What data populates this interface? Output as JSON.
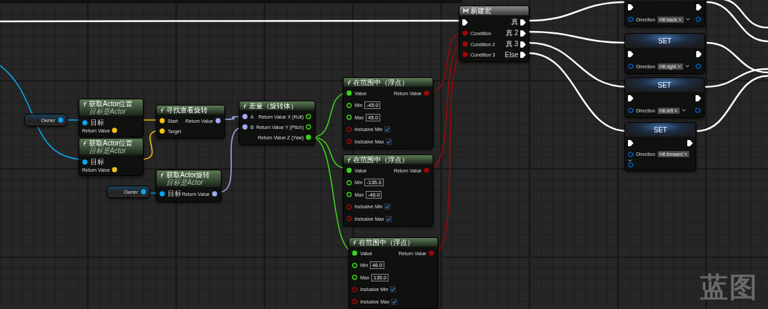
{
  "graph": {
    "watermark": "蓝图",
    "nodes": [
      {
        "kind": "variable",
        "title": "Owner",
        "outputs": [
          {
            "kind": "object",
            "connected": true
          }
        ]
      },
      {
        "kind": "function",
        "title": "获取Actor位置",
        "subtitle": "目标是Actor",
        "inputs": [
          {
            "label": "目标",
            "kind": "object",
            "connected": true
          }
        ],
        "outputs": [
          {
            "label": "Return Value",
            "kind": "vector",
            "connected": true
          }
        ]
      },
      {
        "kind": "function",
        "title": "获取Actor位置",
        "subtitle": "目标是Actor",
        "inputs": [
          {
            "label": "目标",
            "kind": "object",
            "connected": true
          }
        ],
        "outputs": [
          {
            "label": "Return Value",
            "kind": "vector",
            "connected": true
          }
        ]
      },
      {
        "kind": "function",
        "title": "寻找查看旋转",
        "inputs": [
          {
            "label": "Start",
            "kind": "vector",
            "connected": true
          },
          {
            "label": "Target",
            "kind": "vector",
            "connected": true
          }
        ],
        "outputs": [
          {
            "label": "Return Value",
            "kind": "rotator",
            "connected": true
          }
        ]
      },
      {
        "kind": "variable",
        "title": "Owner",
        "outputs": [
          {
            "kind": "object",
            "connected": true
          }
        ]
      },
      {
        "kind": "function",
        "title": "获取Actor旋转",
        "subtitle": "目标是Actor",
        "inputs": [
          {
            "label": "目标",
            "kind": "object",
            "connected": true
          }
        ],
        "outputs": [
          {
            "label": "Return Value",
            "kind": "rotator",
            "connected": true
          }
        ]
      },
      {
        "kind": "function",
        "title": "差量（旋转体）",
        "inputs": [
          {
            "label": "A",
            "kind": "rotator",
            "connected": true
          },
          {
            "label": "B",
            "kind": "rotator",
            "connected": true
          }
        ],
        "outputs": [
          {
            "label": "Return Value X (Roll)",
            "kind": "float",
            "connected": false
          },
          {
            "label": "Return Value Y (Pitch)",
            "kind": "float",
            "connected": false
          },
          {
            "label": "Return Value Z (Yaw)",
            "kind": "float",
            "connected": true
          }
        ]
      },
      {
        "kind": "function",
        "title": "在范围中（浮点）",
        "inputs": [
          {
            "label": "Value",
            "kind": "float",
            "connected": true
          },
          {
            "label": "Min",
            "kind": "float",
            "connected": false,
            "value": "-45.0"
          },
          {
            "label": "Max",
            "kind": "float",
            "connected": false,
            "value": "45.0"
          },
          {
            "label": "Inclusive Min",
            "kind": "bool",
            "connected": false,
            "checked": true
          },
          {
            "label": "Inclusive Max",
            "kind": "bool",
            "connected": false,
            "checked": true
          }
        ],
        "outputs": [
          {
            "label": "Return Value",
            "kind": "bool",
            "connected": true
          }
        ]
      },
      {
        "kind": "function",
        "title": "在范围中（浮点）",
        "inputs": [
          {
            "label": "Value",
            "kind": "float",
            "connected": true
          },
          {
            "label": "Min",
            "kind": "float",
            "connected": false,
            "value": "-135.0"
          },
          {
            "label": "Max",
            "kind": "float",
            "connected": false,
            "value": "-46.0"
          },
          {
            "label": "Inclusive Min",
            "kind": "bool",
            "connected": false,
            "checked": true
          },
          {
            "label": "Inclusive Max",
            "kind": "bool",
            "connected": false,
            "checked": true
          }
        ],
        "outputs": [
          {
            "label": "Return Value",
            "kind": "bool",
            "connected": true
          }
        ]
      },
      {
        "kind": "function",
        "title": "在范围中（浮点）",
        "inputs": [
          {
            "label": "Value",
            "kind": "float",
            "connected": true
          },
          {
            "label": "Min",
            "kind": "float",
            "connected": false,
            "value": "46.0"
          },
          {
            "label": "Max",
            "kind": "float",
            "connected": false,
            "value": "135.0"
          },
          {
            "label": "Inclusive Min",
            "kind": "bool",
            "connected": false,
            "checked": true
          },
          {
            "label": "Inclusive Max",
            "kind": "bool",
            "connected": false,
            "checked": true
          }
        ],
        "outputs": [
          {
            "label": "Return Value",
            "kind": "bool",
            "connected": true
          }
        ]
      },
      {
        "kind": "macro",
        "title": "新建宏",
        "inputs": [
          {
            "kind": "exec",
            "connected": true
          },
          {
            "label": "Condition",
            "kind": "bool",
            "connected": true
          },
          {
            "label": "Condition 2",
            "kind": "bool",
            "connected": true
          },
          {
            "label": "Condition 3",
            "kind": "bool",
            "connected": true
          }
        ],
        "outputs": [
          {
            "label": "真",
            "kind": "exec",
            "connected": true
          },
          {
            "label": "真 2",
            "kind": "exec",
            "connected": true
          },
          {
            "label": "真 3",
            "kind": "exec",
            "connected": true
          },
          {
            "label": "Else",
            "kind": "exec",
            "connected": true
          }
        ]
      },
      {
        "kind": "set",
        "inputs": [
          {
            "kind": "exec",
            "connected": true
          },
          {
            "label": "Direction",
            "kind": "enum",
            "connected": false,
            "value": "Hit.back"
          }
        ],
        "outputs": [
          {
            "kind": "exec",
            "connected": true
          },
          {
            "kind": "enum",
            "connected": false
          }
        ]
      },
      {
        "kind": "set",
        "title": "SET",
        "inputs": [
          {
            "kind": "exec",
            "connected": true
          },
          {
            "label": "Direction",
            "kind": "enum",
            "connected": false,
            "value": "Hit.right"
          }
        ],
        "outputs": [
          {
            "kind": "exec",
            "connected": true
          },
          {
            "kind": "enum",
            "connected": false
          }
        ]
      },
      {
        "kind": "set",
        "title": "SET",
        "inputs": [
          {
            "kind": "exec",
            "connected": true
          },
          {
            "label": "Direction",
            "kind": "enum",
            "connected": false,
            "value": "Hit.left"
          }
        ],
        "outputs": [
          {
            "kind": "exec",
            "connected": true
          },
          {
            "kind": "enum",
            "connected": false
          }
        ]
      },
      {
        "kind": "set",
        "title": "SET",
        "inputs": [
          {
            "kind": "exec",
            "connected": true
          },
          {
            "label": "Direction",
            "kind": "enum",
            "connected": false,
            "value": "Hit.forward"
          }
        ],
        "outputs": [
          {
            "kind": "exec",
            "connected": true
          },
          {
            "kind": "enum",
            "connected": false
          }
        ]
      }
    ]
  }
}
